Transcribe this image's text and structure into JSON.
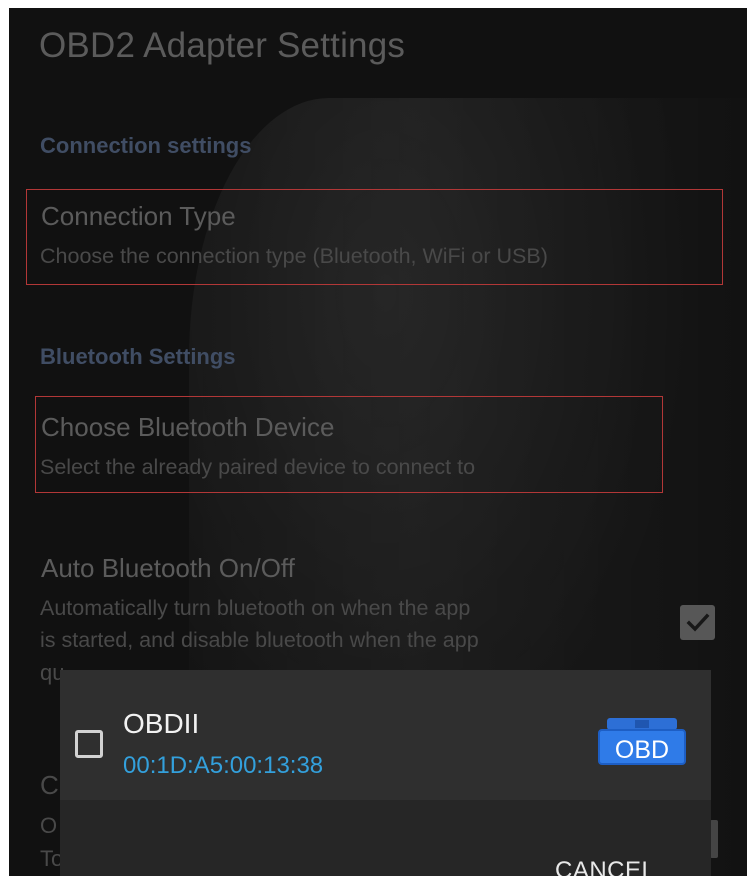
{
  "screen": {
    "title": "OBD2 Adapter Settings"
  },
  "settings": {
    "connection_section": "Connection settings",
    "connection_type": {
      "title": "Connection Type",
      "summary": "Choose the connection type (Bluetooth, WiFi or USB)"
    },
    "bluetooth_section": "Bluetooth Settings",
    "choose_device": {
      "title": "Choose Bluetooth Device",
      "summary": "Select the already paired device to connect to"
    },
    "auto_bluetooth": {
      "title": "Auto Bluetooth On/Off",
      "summary_line1": "Automatically turn bluetooth on when the app",
      "summary_line2": "is started, and disable bluetooth when the app",
      "summary_line3_fragment": "qu",
      "checked": true
    },
    "hidden_fragments": [
      "C",
      "O",
      "To"
    ]
  },
  "dialog": {
    "device": {
      "name": "OBDII",
      "address": "00:1D:A5:00:13:38",
      "icon_label": "OBD",
      "checked": false
    },
    "cancel_label": "CANCEL"
  },
  "colors": {
    "background": "#151515",
    "accent_blue": "#33a0dc",
    "highlight_red": "#d94444",
    "dialog_bg": "#2b2b2b"
  }
}
